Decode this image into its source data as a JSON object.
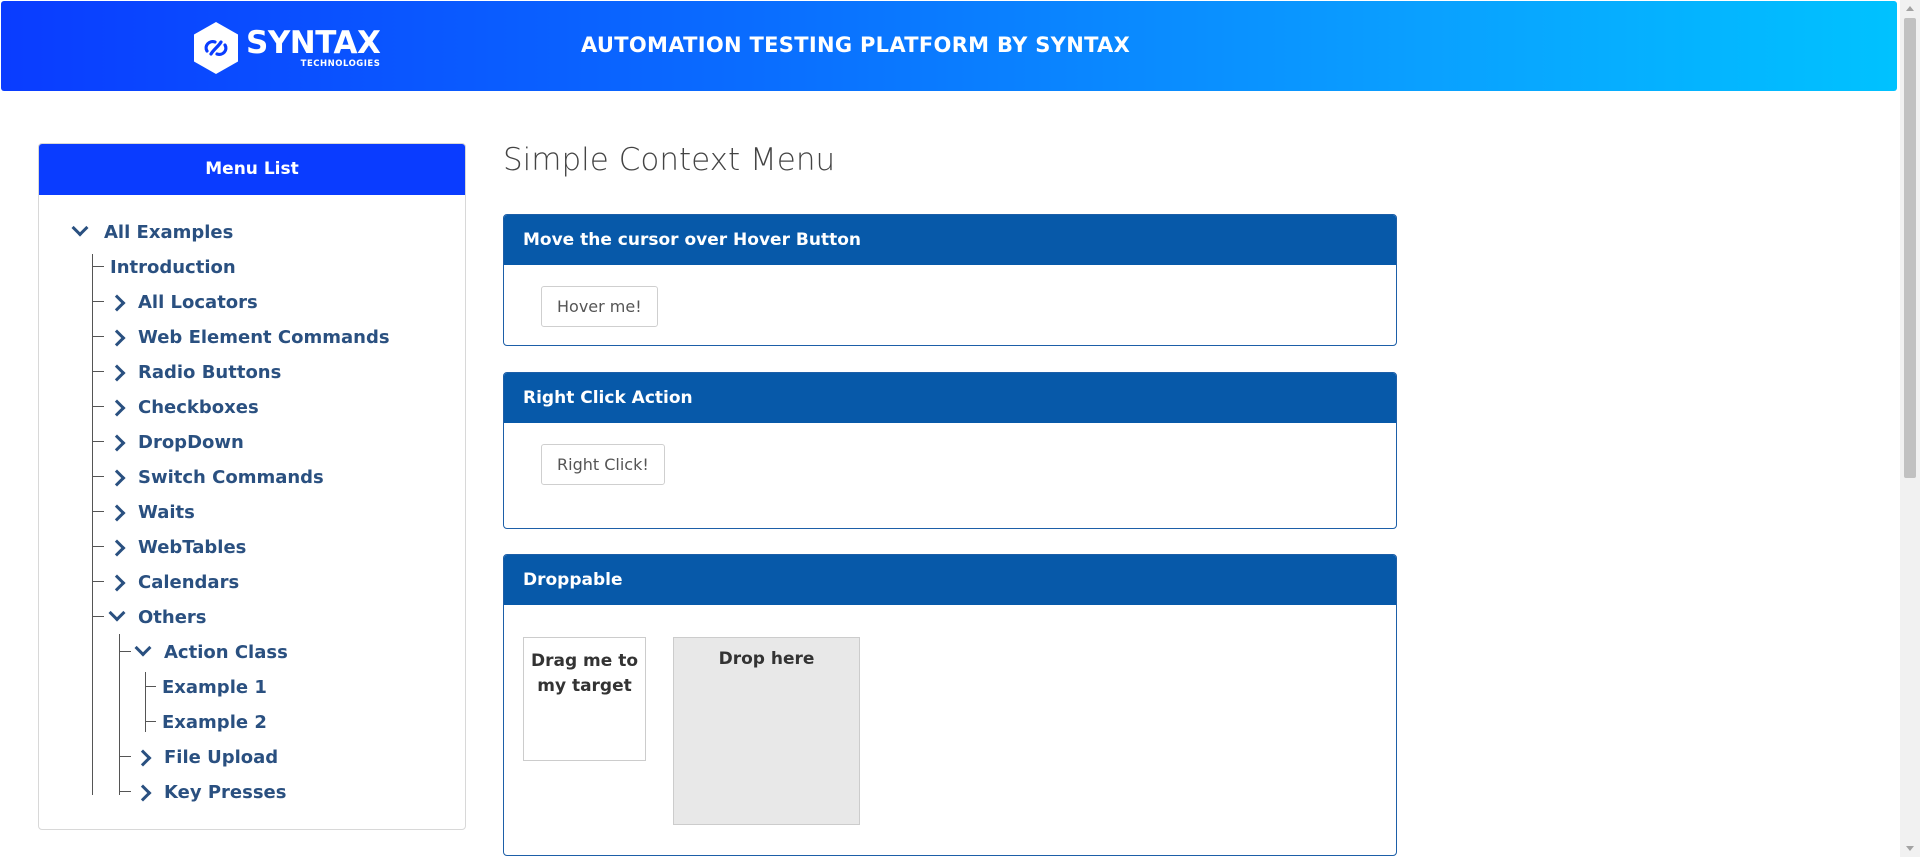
{
  "header": {
    "logo_name": "SYNTAX",
    "logo_sub": "TECHNOLOGIES",
    "title": "AUTOMATION TESTING PLATFORM BY SYNTAX",
    "gradient_start": "#0a3cff",
    "gradient_end": "#00c2ff"
  },
  "sidebar": {
    "heading": "Menu List",
    "items": [
      {
        "label": "All Examples",
        "icon": "chevron-down-icon"
      },
      {
        "label": "Introduction"
      },
      {
        "label": "All Locators",
        "icon": "chevron-right-icon"
      },
      {
        "label": "Web Element Commands",
        "icon": "chevron-right-icon"
      },
      {
        "label": "Radio Buttons",
        "icon": "chevron-right-icon"
      },
      {
        "label": "Checkboxes",
        "icon": "chevron-right-icon"
      },
      {
        "label": "DropDown",
        "icon": "chevron-right-icon"
      },
      {
        "label": "Switch Commands",
        "icon": "chevron-right-icon"
      },
      {
        "label": "Waits",
        "icon": "chevron-right-icon"
      },
      {
        "label": "WebTables",
        "icon": "chevron-right-icon"
      },
      {
        "label": "Calendars",
        "icon": "chevron-right-icon"
      },
      {
        "label": "Others",
        "icon": "chevron-down-icon"
      },
      {
        "label": "Action Class",
        "icon": "chevron-down-icon"
      },
      {
        "label": "Example 1"
      },
      {
        "label": "Example 2"
      },
      {
        "label": "File Upload",
        "icon": "chevron-right-icon"
      },
      {
        "label": "Key Presses",
        "icon": "chevron-right-icon"
      }
    ]
  },
  "main": {
    "page_title": "Simple Context Menu",
    "panels": [
      {
        "heading": "Move the cursor over Hover Button",
        "button": "Hover me!"
      },
      {
        "heading": "Right Click Action",
        "button": "Right Click!"
      },
      {
        "heading": "Droppable",
        "drag_text": "Drag me to my target",
        "drop_text": "Drop here"
      }
    ]
  },
  "colors": {
    "panel_header": "#0759a9",
    "menu_header": "#0a3cff",
    "tree_text": "#2a5080"
  }
}
